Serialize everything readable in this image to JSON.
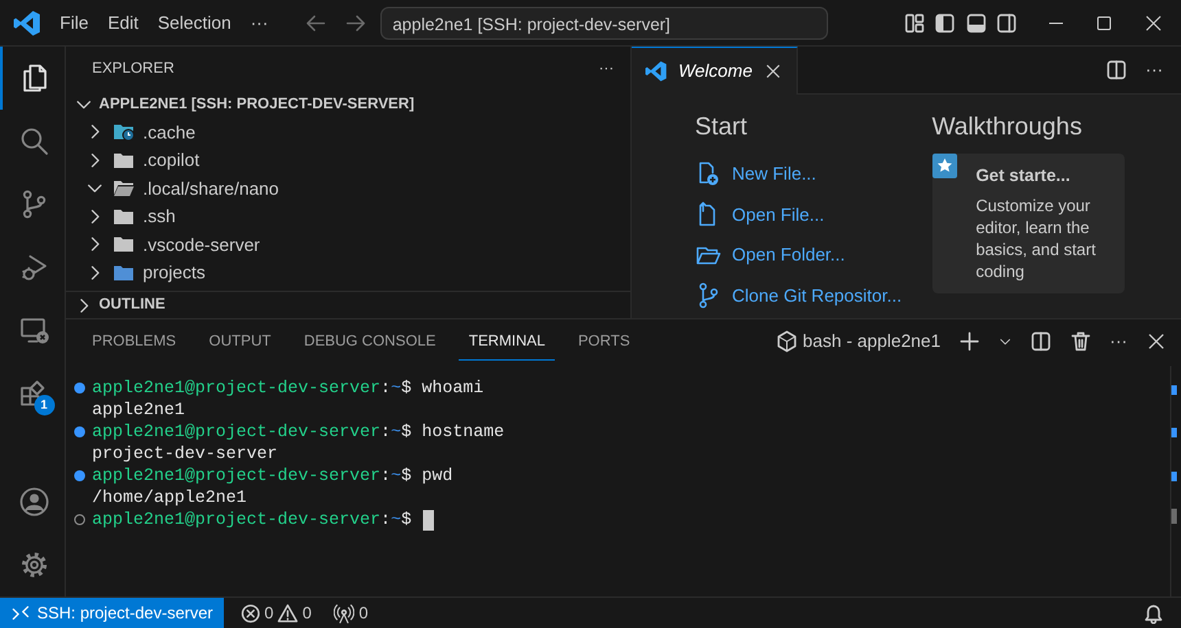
{
  "title_bar": {
    "menus": [
      "File",
      "Edit",
      "Selection"
    ],
    "more": "···",
    "command_center": "apple2ne1 [SSH: project-dev-server]"
  },
  "activity_bar": {
    "items": [
      {
        "kind": "explorer",
        "selected": true
      },
      {
        "kind": "search",
        "selected": false
      },
      {
        "kind": "source-control",
        "selected": false
      },
      {
        "kind": "run-debug",
        "selected": false
      },
      {
        "kind": "remote-explorer",
        "selected": false
      },
      {
        "kind": "extensions",
        "selected": false,
        "badge": "1"
      }
    ],
    "bottom": [
      {
        "kind": "account"
      },
      {
        "kind": "settings"
      }
    ]
  },
  "sidebar": {
    "title": "EXPLORER",
    "more": "···",
    "root": {
      "label": "APPLE2NE1 [SSH: PROJECT-DEV-SERVER]",
      "expanded": true
    },
    "items": [
      {
        "label": ".cache",
        "kind": "folder-cache",
        "expanded": false
      },
      {
        "label": ".copilot",
        "kind": "folder",
        "expanded": false
      },
      {
        "label": ".local/share/nano",
        "kind": "folder",
        "expanded": true
      },
      {
        "label": ".ssh",
        "kind": "folder",
        "expanded": false
      },
      {
        "label": ".vscode-server",
        "kind": "folder",
        "expanded": false
      },
      {
        "label": "projects",
        "kind": "folder-blue",
        "expanded": false
      }
    ],
    "sections": [
      {
        "label": "OUTLINE",
        "expanded": false
      }
    ]
  },
  "editor": {
    "tabs": [
      {
        "label": "Welcome",
        "selected": true
      }
    ],
    "start_title": "Start",
    "start_items": [
      {
        "kind": "new-file",
        "label": "New File..."
      },
      {
        "kind": "open-file",
        "label": "Open File..."
      },
      {
        "kind": "open-folder",
        "label": "Open Folder..."
      },
      {
        "kind": "clone",
        "label": "Clone Git Repositor..."
      }
    ],
    "walkthroughs_title": "Walkthroughs",
    "walkthrough": {
      "title": "Get starte...",
      "description": "Customize your editor, learn the basics, and start coding"
    }
  },
  "panel": {
    "tabs": [
      {
        "label": "PROBLEMS",
        "selected": false
      },
      {
        "label": "OUTPUT",
        "selected": false
      },
      {
        "label": "DEBUG CONSOLE",
        "selected": false
      },
      {
        "label": "TERMINAL",
        "selected": true
      },
      {
        "label": "PORTS",
        "selected": false
      }
    ],
    "terminal_name": "bash - apple2ne1",
    "lines": [
      {
        "kind": "prompt",
        "command_done": true,
        "host": "apple2ne1@project-dev-server",
        "colon": ":",
        "path": "~",
        "symbol": "$",
        "command": "whoami"
      },
      {
        "kind": "output",
        "text": "apple2ne1"
      },
      {
        "kind": "prompt",
        "command_done": true,
        "host": "apple2ne1@project-dev-server",
        "colon": ":",
        "path": "~",
        "symbol": "$",
        "command": "hostname"
      },
      {
        "kind": "output",
        "text": "project-dev-server"
      },
      {
        "kind": "prompt",
        "command_done": true,
        "host": "apple2ne1@project-dev-server",
        "colon": ":",
        "path": "~",
        "symbol": "$",
        "command": "pwd"
      },
      {
        "kind": "output",
        "text": "/home/apple2ne1"
      },
      {
        "kind": "prompt",
        "command_done": false,
        "host": "apple2ne1@project-dev-server",
        "colon": ":",
        "path": "~",
        "symbol": "$",
        "cursor": true
      }
    ]
  },
  "status_bar": {
    "remote": "SSH: project-dev-server",
    "errors": "0",
    "warnings": "0",
    "ports": "0"
  }
}
